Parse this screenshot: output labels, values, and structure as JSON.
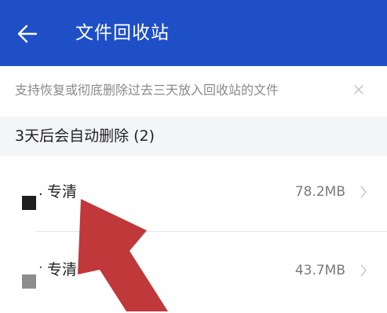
{
  "header": {
    "title": "文件回收站",
    "back_icon": "back-arrow-icon"
  },
  "notice": {
    "text": "支持恢复或彻底删除过去三天放入回收站的文件",
    "close_icon": "close-icon"
  },
  "section": {
    "label": "3天后会自动删除 (2)"
  },
  "files": [
    {
      "name": "专清",
      "size": "78.2MB",
      "thumb_color": "#1e1e1e"
    },
    {
      "name": "专清",
      "size": "43.7MB",
      "thumb_color": "#8d8d8d"
    }
  ],
  "colors": {
    "header_bg": "#1f4fc7",
    "section_bg": "#f4f5f7",
    "annotation_arrow": "#c0383a"
  }
}
